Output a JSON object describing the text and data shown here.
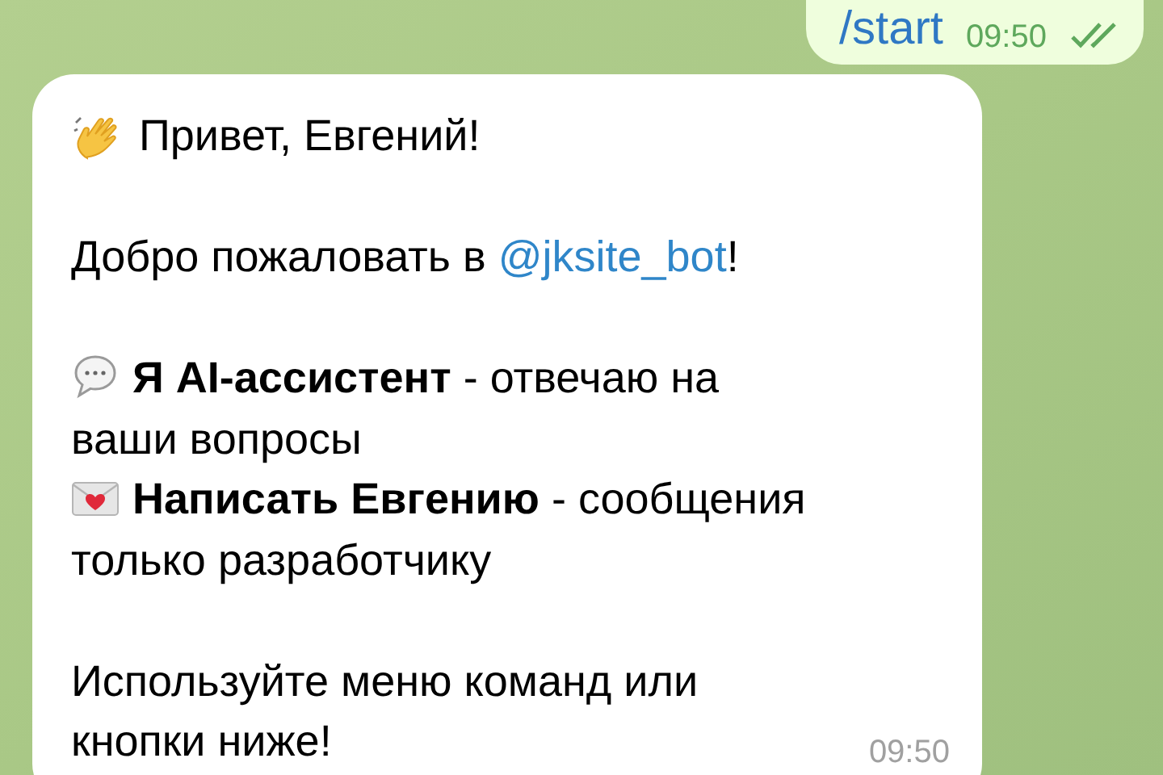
{
  "outgoing": {
    "text": "/start",
    "time": "09:50",
    "read": true
  },
  "incoming": {
    "greeting": "Привет, Евгений!",
    "welcome": {
      "before": "Добро пожаловать в ",
      "link": "@jksite_bot",
      "after": "!"
    },
    "features": [
      {
        "kind": "chat",
        "text": "**Я AI-ассистент** - отвечаю на ваши вопросы"
      },
      {
        "kind": "mail",
        "text": "**Написать Евгению** - сообщения только разработчику"
      }
    ],
    "footer": "Используйте меню команд или кнопки ниже!",
    "time": "09:50"
  }
}
